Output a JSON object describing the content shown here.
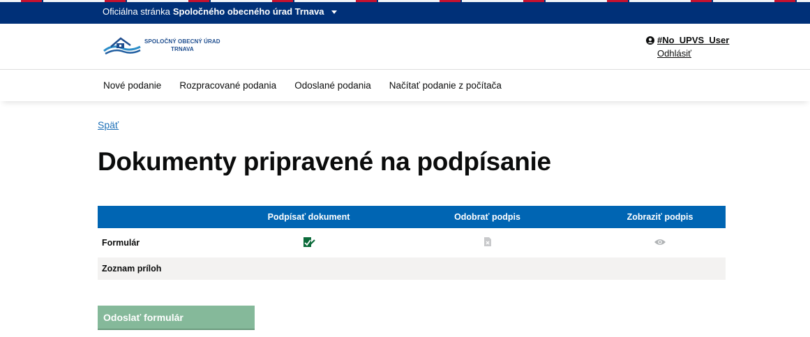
{
  "topbar": {
    "prefix": "Oficiálna stránka",
    "org": "Spoločného obecného úrad Trnava"
  },
  "logo": {
    "line1": "SPOLOČNÝ OBECNÝ ÚRAD",
    "line2": "TRNAVA"
  },
  "user": {
    "name": "#No_UPVS_User",
    "logout": "Odhlásiť"
  },
  "nav": {
    "items": [
      {
        "label": "Nové podanie"
      },
      {
        "label": "Rozpracované podania"
      },
      {
        "label": "Odoslané podania"
      },
      {
        "label": "Načítať podanie z počítača"
      }
    ]
  },
  "main": {
    "back": "Späť",
    "title": "Dokumenty pripravené na podpísanie",
    "table": {
      "headers": [
        "",
        "Podpísať dokument",
        "Odobrať podpis",
        "Zobraziť podpis"
      ],
      "rows": [
        {
          "label": "Formulár",
          "icons": [
            "sign-document-icon",
            "remove-signature-icon",
            "eye-icon"
          ]
        },
        {
          "label": "Zoznam príloh",
          "icons": []
        }
      ]
    },
    "submit": "Odoslať formulár"
  },
  "colors": {
    "topbar": "#003078",
    "table_header": "#0065b3",
    "submit_button": "#85b99a",
    "sign_icon": "#0b6b3a",
    "disabled_icon": "#b1b4b6"
  }
}
